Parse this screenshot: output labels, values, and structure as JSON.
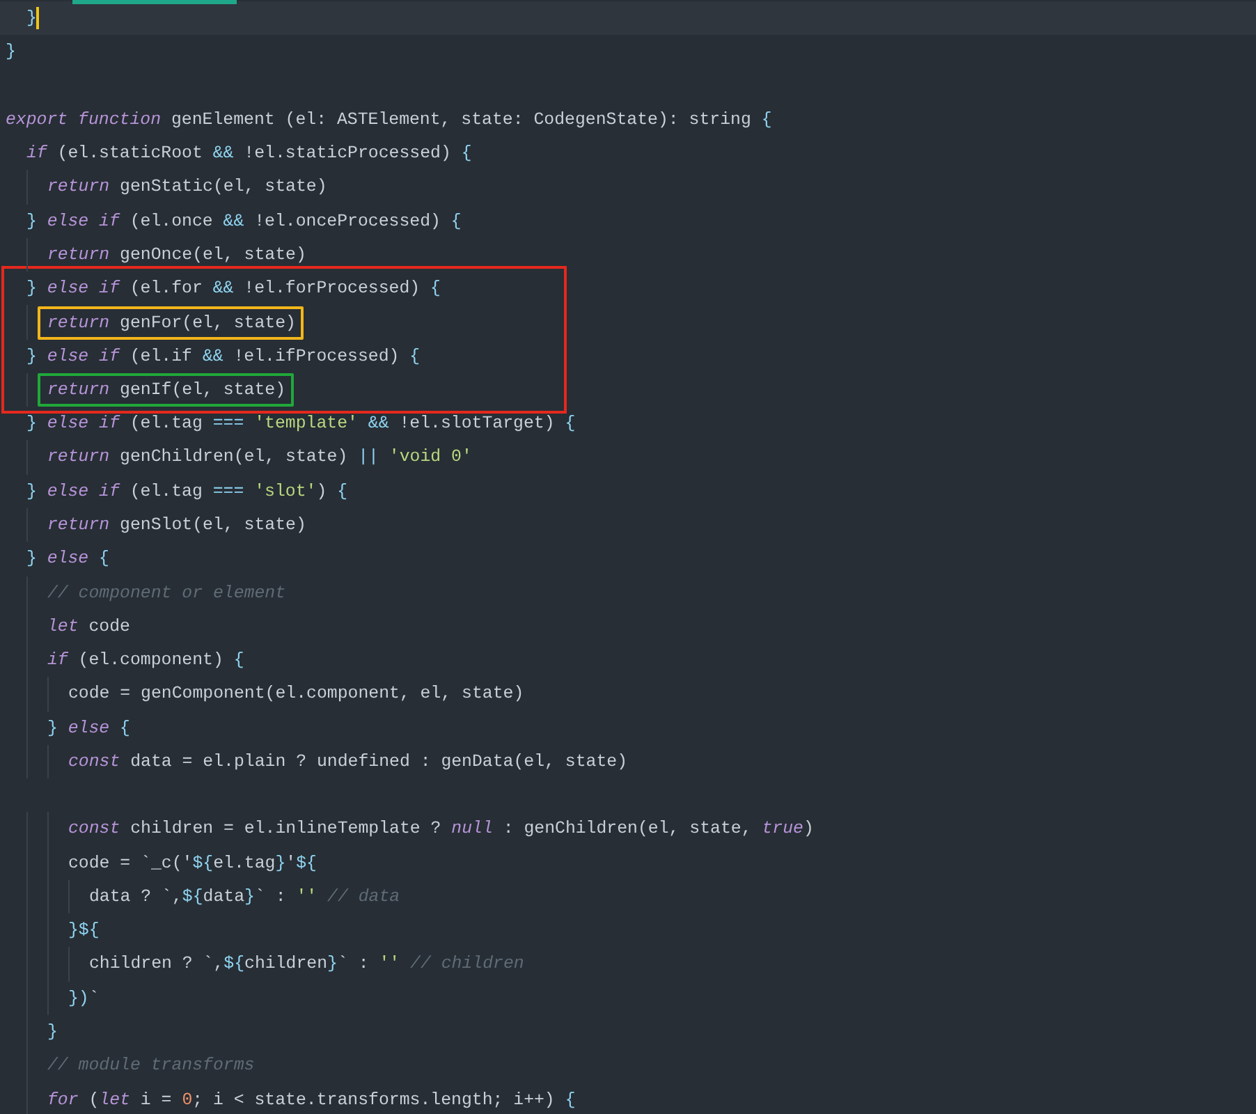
{
  "editor": {
    "lines": [
      {
        "kind": "code",
        "current": true,
        "tokens": [
          {
            "kind": "punct",
            "text": "  }"
          }
        ]
      },
      {
        "kind": "code",
        "current": false,
        "tokens": [
          {
            "kind": "punct",
            "text": "}"
          }
        ]
      },
      {
        "kind": "blank"
      },
      {
        "kind": "code",
        "current": false,
        "tokens": [
          {
            "kind": "keyword",
            "text": "export function"
          },
          {
            "kind": "plain",
            "text": " genElement (el: ASTElement, state: CodegenState): string "
          },
          {
            "kind": "punct",
            "text": "{"
          }
        ]
      },
      {
        "kind": "code",
        "current": false,
        "tokens": [
          {
            "kind": "keyword",
            "text": "  if"
          },
          {
            "kind": "plain",
            "text": " (el.staticRoot "
          },
          {
            "kind": "punct",
            "text": "&&"
          },
          {
            "kind": "plain",
            "text": " !el.staticProcessed) "
          },
          {
            "kind": "punct",
            "text": "{"
          }
        ]
      },
      {
        "kind": "code",
        "current": false,
        "tokens": [
          {
            "kind": "keyword",
            "text": "    return"
          },
          {
            "kind": "plain",
            "text": " genStatic(el, state)"
          }
        ]
      },
      {
        "kind": "code",
        "current": false,
        "tokens": [
          {
            "kind": "punct",
            "text": "  }"
          },
          {
            "kind": "keyword",
            "text": " else if"
          },
          {
            "kind": "plain",
            "text": " (el.once "
          },
          {
            "kind": "punct",
            "text": "&&"
          },
          {
            "kind": "plain",
            "text": " !el.onceProcessed) "
          },
          {
            "kind": "punct",
            "text": "{"
          }
        ]
      },
      {
        "kind": "code",
        "current": false,
        "tokens": [
          {
            "kind": "keyword",
            "text": "    return"
          },
          {
            "kind": "plain",
            "text": " genOnce(el, state)"
          }
        ]
      },
      {
        "kind": "group",
        "color": "#e5281e",
        "lines": [
          {
            "kind": "code",
            "current": false,
            "tokens": [
              {
                "kind": "punct",
                "text": "  }"
              },
              {
                "kind": "keyword",
                "text": " else if"
              },
              {
                "kind": "plain",
                "text": " (el.for "
              },
              {
                "kind": "punct",
                "text": "&&"
              },
              {
                "kind": "plain",
                "text": " !el.forProcessed) "
              },
              {
                "kind": "punct",
                "text": "{"
              }
            ]
          },
          {
            "kind": "code",
            "current": false,
            "color": "#f2b51b",
            "tokens": [
              {
                "kind": "keyword",
                "text": "    return"
              },
              {
                "kind": "plain",
                "text": " genFor(el, state)"
              }
            ]
          },
          {
            "kind": "code",
            "current": false,
            "tokens": [
              {
                "kind": "punct",
                "text": "  }"
              },
              {
                "kind": "keyword",
                "text": " else if"
              },
              {
                "kind": "plain",
                "text": " (el.if "
              },
              {
                "kind": "punct",
                "text": "&&"
              },
              {
                "kind": "plain",
                "text": " !el.ifProcessed) "
              },
              {
                "kind": "punct",
                "text": "{"
              }
            ]
          },
          {
            "kind": "code",
            "current": false,
            "color": "#1fa83a",
            "tokens": [
              {
                "kind": "keyword",
                "text": "    return"
              },
              {
                "kind": "plain",
                "text": " genIf(el, state)"
              }
            ]
          }
        ]
      },
      {
        "kind": "code",
        "current": false,
        "tokens": [
          {
            "kind": "punct",
            "text": "  }"
          },
          {
            "kind": "keyword",
            "text": " else if"
          },
          {
            "kind": "plain",
            "text": " (el.tag "
          },
          {
            "kind": "punct",
            "text": "==="
          },
          {
            "kind": "string",
            "text": " 'template'"
          },
          {
            "kind": "punct",
            "text": " &&"
          },
          {
            "kind": "plain",
            "text": " !el.slotTarget) "
          },
          {
            "kind": "punct",
            "text": "{"
          }
        ]
      },
      {
        "kind": "code",
        "current": false,
        "tokens": [
          {
            "kind": "keyword",
            "text": "    return"
          },
          {
            "kind": "plain",
            "text": " genChildren(el, state) "
          },
          {
            "kind": "punct",
            "text": "||"
          },
          {
            "kind": "string",
            "text": " 'void 0'"
          }
        ]
      },
      {
        "kind": "code",
        "current": false,
        "tokens": [
          {
            "kind": "punct",
            "text": "  }"
          },
          {
            "kind": "keyword",
            "text": " else if"
          },
          {
            "kind": "plain",
            "text": " (el.tag "
          },
          {
            "kind": "punct",
            "text": "==="
          },
          {
            "kind": "string",
            "text": " 'slot'"
          },
          {
            "kind": "plain",
            "text": ") "
          },
          {
            "kind": "punct",
            "text": "{"
          }
        ]
      },
      {
        "kind": "code",
        "current": false,
        "tokens": [
          {
            "kind": "keyword",
            "text": "    return"
          },
          {
            "kind": "plain",
            "text": " genSlot(el, state)"
          }
        ]
      },
      {
        "kind": "code",
        "current": false,
        "tokens": [
          {
            "kind": "punct",
            "text": "  }"
          },
          {
            "kind": "keyword",
            "text": " else"
          },
          {
            "kind": "punct",
            "text": " {"
          }
        ]
      },
      {
        "kind": "code",
        "current": false,
        "tokens": [
          {
            "kind": "comment",
            "text": "    // component or element"
          }
        ]
      },
      {
        "kind": "code",
        "current": false,
        "tokens": [
          {
            "kind": "keyword",
            "text": "    let"
          },
          {
            "kind": "plain",
            "text": " code"
          }
        ]
      },
      {
        "kind": "code",
        "current": false,
        "tokens": [
          {
            "kind": "keyword",
            "text": "    if"
          },
          {
            "kind": "plain",
            "text": " (el.component) "
          },
          {
            "kind": "punct",
            "text": "{"
          }
        ]
      },
      {
        "kind": "code",
        "current": false,
        "tokens": [
          {
            "kind": "plain",
            "text": "      code = genComponent(el.component, el, state)"
          }
        ]
      },
      {
        "kind": "code",
        "current": false,
        "tokens": [
          {
            "kind": "punct",
            "text": "    }"
          },
          {
            "kind": "keyword",
            "text": " else"
          },
          {
            "kind": "punct",
            "text": " {"
          }
        ]
      },
      {
        "kind": "code",
        "current": false,
        "tokens": [
          {
            "kind": "keyword",
            "text": "      const"
          },
          {
            "kind": "plain",
            "text": " data = el.plain ? undefined : genData(el, state)"
          }
        ]
      },
      {
        "kind": "blank"
      },
      {
        "kind": "code",
        "current": false,
        "tokens": [
          {
            "kind": "keyword",
            "text": "      const"
          },
          {
            "kind": "plain",
            "text": " children = el.inlineTemplate ? "
          },
          {
            "kind": "keyword",
            "text": "null"
          },
          {
            "kind": "plain",
            "text": " : genChildren(el, state, "
          },
          {
            "kind": "keyword",
            "text": "true"
          },
          {
            "kind": "plain",
            "text": ")"
          }
        ]
      },
      {
        "kind": "code",
        "current": false,
        "tokens": [
          {
            "kind": "plain",
            "text": "      code = `_c('"
          },
          {
            "kind": "punct",
            "text": "${"
          },
          {
            "kind": "plain",
            "text": "el.tag"
          },
          {
            "kind": "punct",
            "text": "}"
          },
          {
            "kind": "plain",
            "text": "'"
          },
          {
            "kind": "punct",
            "text": "${"
          }
        ]
      },
      {
        "kind": "code",
        "current": false,
        "tokens": [
          {
            "kind": "plain",
            "text": "        data ? `,"
          },
          {
            "kind": "punct",
            "text": "${"
          },
          {
            "kind": "plain",
            "text": "data"
          },
          {
            "kind": "punct",
            "text": "}"
          },
          {
            "kind": "plain",
            "text": "` : "
          },
          {
            "kind": "string",
            "text": "''"
          },
          {
            "kind": "comment",
            "text": " // data"
          }
        ]
      },
      {
        "kind": "code",
        "current": false,
        "tokens": [
          {
            "kind": "punct",
            "text": "      }${"
          }
        ]
      },
      {
        "kind": "code",
        "current": false,
        "tokens": [
          {
            "kind": "plain",
            "text": "        children ? `,"
          },
          {
            "kind": "punct",
            "text": "${"
          },
          {
            "kind": "plain",
            "text": "children"
          },
          {
            "kind": "punct",
            "text": "}"
          },
          {
            "kind": "plain",
            "text": "` : "
          },
          {
            "kind": "string",
            "text": "''"
          },
          {
            "kind": "comment",
            "text": " // children"
          }
        ]
      },
      {
        "kind": "code",
        "current": false,
        "tokens": [
          {
            "kind": "punct",
            "text": "      })"
          },
          {
            "kind": "plain",
            "text": "`"
          }
        ]
      },
      {
        "kind": "code",
        "current": false,
        "tokens": [
          {
            "kind": "punct",
            "text": "    }"
          }
        ]
      },
      {
        "kind": "code",
        "current": false,
        "tokens": [
          {
            "kind": "comment",
            "text": "    // module transforms"
          }
        ]
      },
      {
        "kind": "code",
        "current": false,
        "tokens": [
          {
            "kind": "keyword",
            "text": "    for"
          },
          {
            "kind": "plain",
            "text": " ("
          },
          {
            "kind": "keyword",
            "text": "let"
          },
          {
            "kind": "plain",
            "text": " i = "
          },
          {
            "kind": "number",
            "text": "0"
          },
          {
            "kind": "plain",
            "text": "; i < state.transforms.length; i++) "
          },
          {
            "kind": "punct",
            "text": "{"
          }
        ]
      }
    ]
  }
}
